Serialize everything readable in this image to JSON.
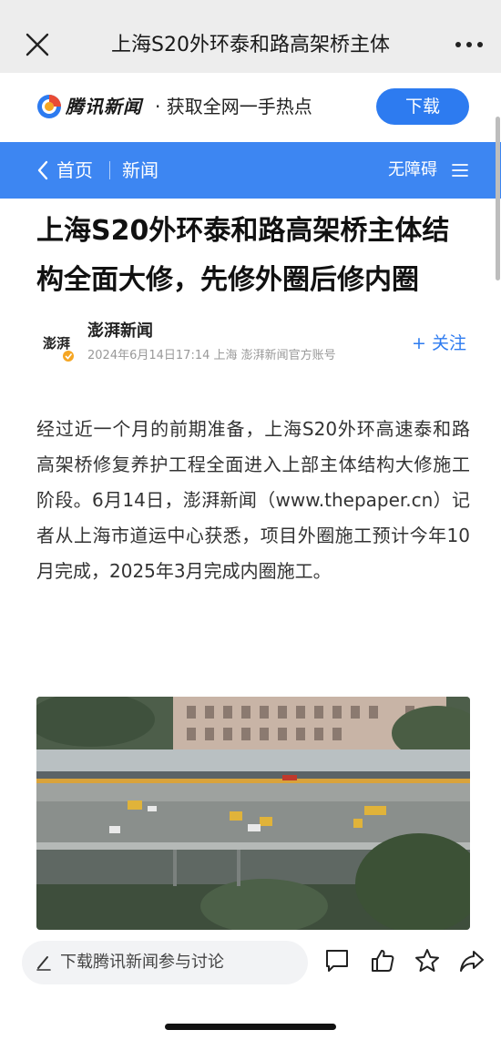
{
  "topbar": {
    "title": "上海S20外环泰和路高架桥主体",
    "close_icon": "close-icon",
    "more_icon": "more-icon"
  },
  "app_banner": {
    "logo_text": "腾讯新闻",
    "slogan": "· 获取全网一手热点",
    "download_label": "下载"
  },
  "nav": {
    "home_label": "首页",
    "section_label": "新闻",
    "accessibility_label": "无障碍",
    "accent_color": "#3d86f2"
  },
  "article": {
    "title": "上海S20外环泰和路高架桥主体结构全面大修，先修外圈后修内圈",
    "author": {
      "avatar_text": "澎湃",
      "name": "澎湃新闻",
      "meta": "2024年6月14日17:14  上海  澎湃新闻官方账号",
      "follow_label": "+ 关注"
    },
    "body": "经过近一个月的前期准备，上海S20外环高速泰和路高架桥修复养护工程全面进入上部主体结构大修施工阶段。6月14日，澎湃新闻（www.thepaper.cn）记者从上海市道运中心获悉，项目外圈施工预计今年10月完成，2025年3月完成内圈施工。"
  },
  "bottom_bar": {
    "comment_placeholder": "下载腾讯新闻参与讨论",
    "actions": [
      "comment-icon",
      "like-icon",
      "star-icon",
      "share-icon"
    ]
  },
  "colors": {
    "brand_blue": "#2d7bf0",
    "text_primary": "#111111",
    "text_meta": "#999999"
  }
}
